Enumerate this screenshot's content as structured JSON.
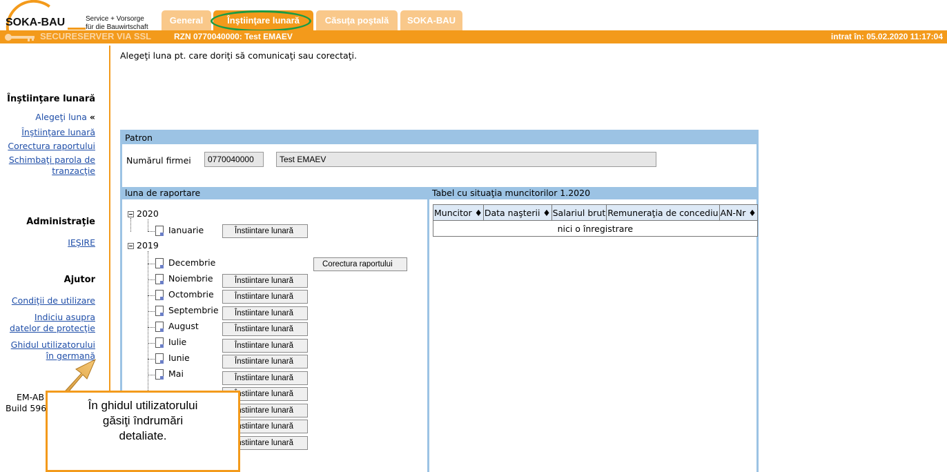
{
  "header": {
    "logo_name": "SOKA-BAU",
    "logo_tagline_1": "Service + Vorsorge",
    "logo_tagline_2": "für die Bauwirtschaft",
    "tabs": [
      {
        "label": "General"
      },
      {
        "label": "Înştiinţare lunară"
      },
      {
        "label": "Căsuţa poştală"
      },
      {
        "label": "SOKA-BAU"
      }
    ],
    "secure_label": "SECURESERVER VIA SSL",
    "rzn": "RZN 0770040000: Test EMAEV",
    "login_time": "intrat în:  05.02.2020 11:17:04",
    "accent_color": "#f39a1b"
  },
  "sidebar": {
    "section1_title": "Înştiinţare lunară",
    "items1": [
      "Alegeţi luna",
      "Înştiinţare lunară",
      "Corectura raportului",
      "Schimbaţi parola de",
      "tranzacţie"
    ],
    "active_marker": "«",
    "section2_title": "Administraţie",
    "logout": "IEŞIRE",
    "section3_title": "Ajutor",
    "help_items": [
      "Condiţii de utilizare",
      "Indiciu asupra",
      "datelor de protecţie",
      "Ghidul utilizatorului",
      "în germană"
    ],
    "build_line_1": "EM-AB",
    "build_line_2": "Build 596"
  },
  "main": {
    "instruction": "Alegeţi luna pt. care doriţi să comunicaţi sau corectaţi.",
    "patron_header": "Patron",
    "firm_label": "Numărul firmei",
    "firm_number": "0770040000",
    "firm_name": "Test EMAEV",
    "left_header": "luna de raportare",
    "right_header": "Tabel cu situaţia muncitorilor 1.2020",
    "tree": {
      "year1": "2020",
      "year1_months": [
        {
          "name": "Ianuarie",
          "button": "Înstiintare lunară"
        }
      ],
      "year2": "2019",
      "decembrie": "Decembrie",
      "correct_button": "Corectura raportului",
      "year2_months": [
        {
          "name": "Noiembrie",
          "button": "Înstiintare lunară"
        },
        {
          "name": "Octombrie",
          "button": "Înstiintare lunară"
        },
        {
          "name": "Septembrie",
          "button": "Înstiintare lunară"
        },
        {
          "name": "August",
          "button": "Înstiintare lunară"
        },
        {
          "name": "Iulie",
          "button": "Înstiintare lunară"
        },
        {
          "name": "Iunie",
          "button": "Înstiintare lunară"
        },
        {
          "name": "Mai",
          "button": "Înstiintare lunară"
        },
        {
          "name": "",
          "button": "Înstiintare lunară"
        },
        {
          "name": "",
          "button": "Înstiintare lunară"
        },
        {
          "name": "",
          "button": "Înstiintare lunară"
        },
        {
          "name": "",
          "button": "Înstiintare lunară"
        }
      ]
    },
    "table": {
      "columns": [
        "Muncitor ♦",
        "Data naşterii ♦",
        "Salariul brut",
        "Remuneraţia de concediu",
        "AN-Nr ♦"
      ],
      "empty_message": "nici o înregistrare"
    }
  },
  "callout": {
    "text_1": "În ghidul utilizatorului",
    "text_2": "găsiţi îndrumări",
    "text_3": "detaliate."
  }
}
